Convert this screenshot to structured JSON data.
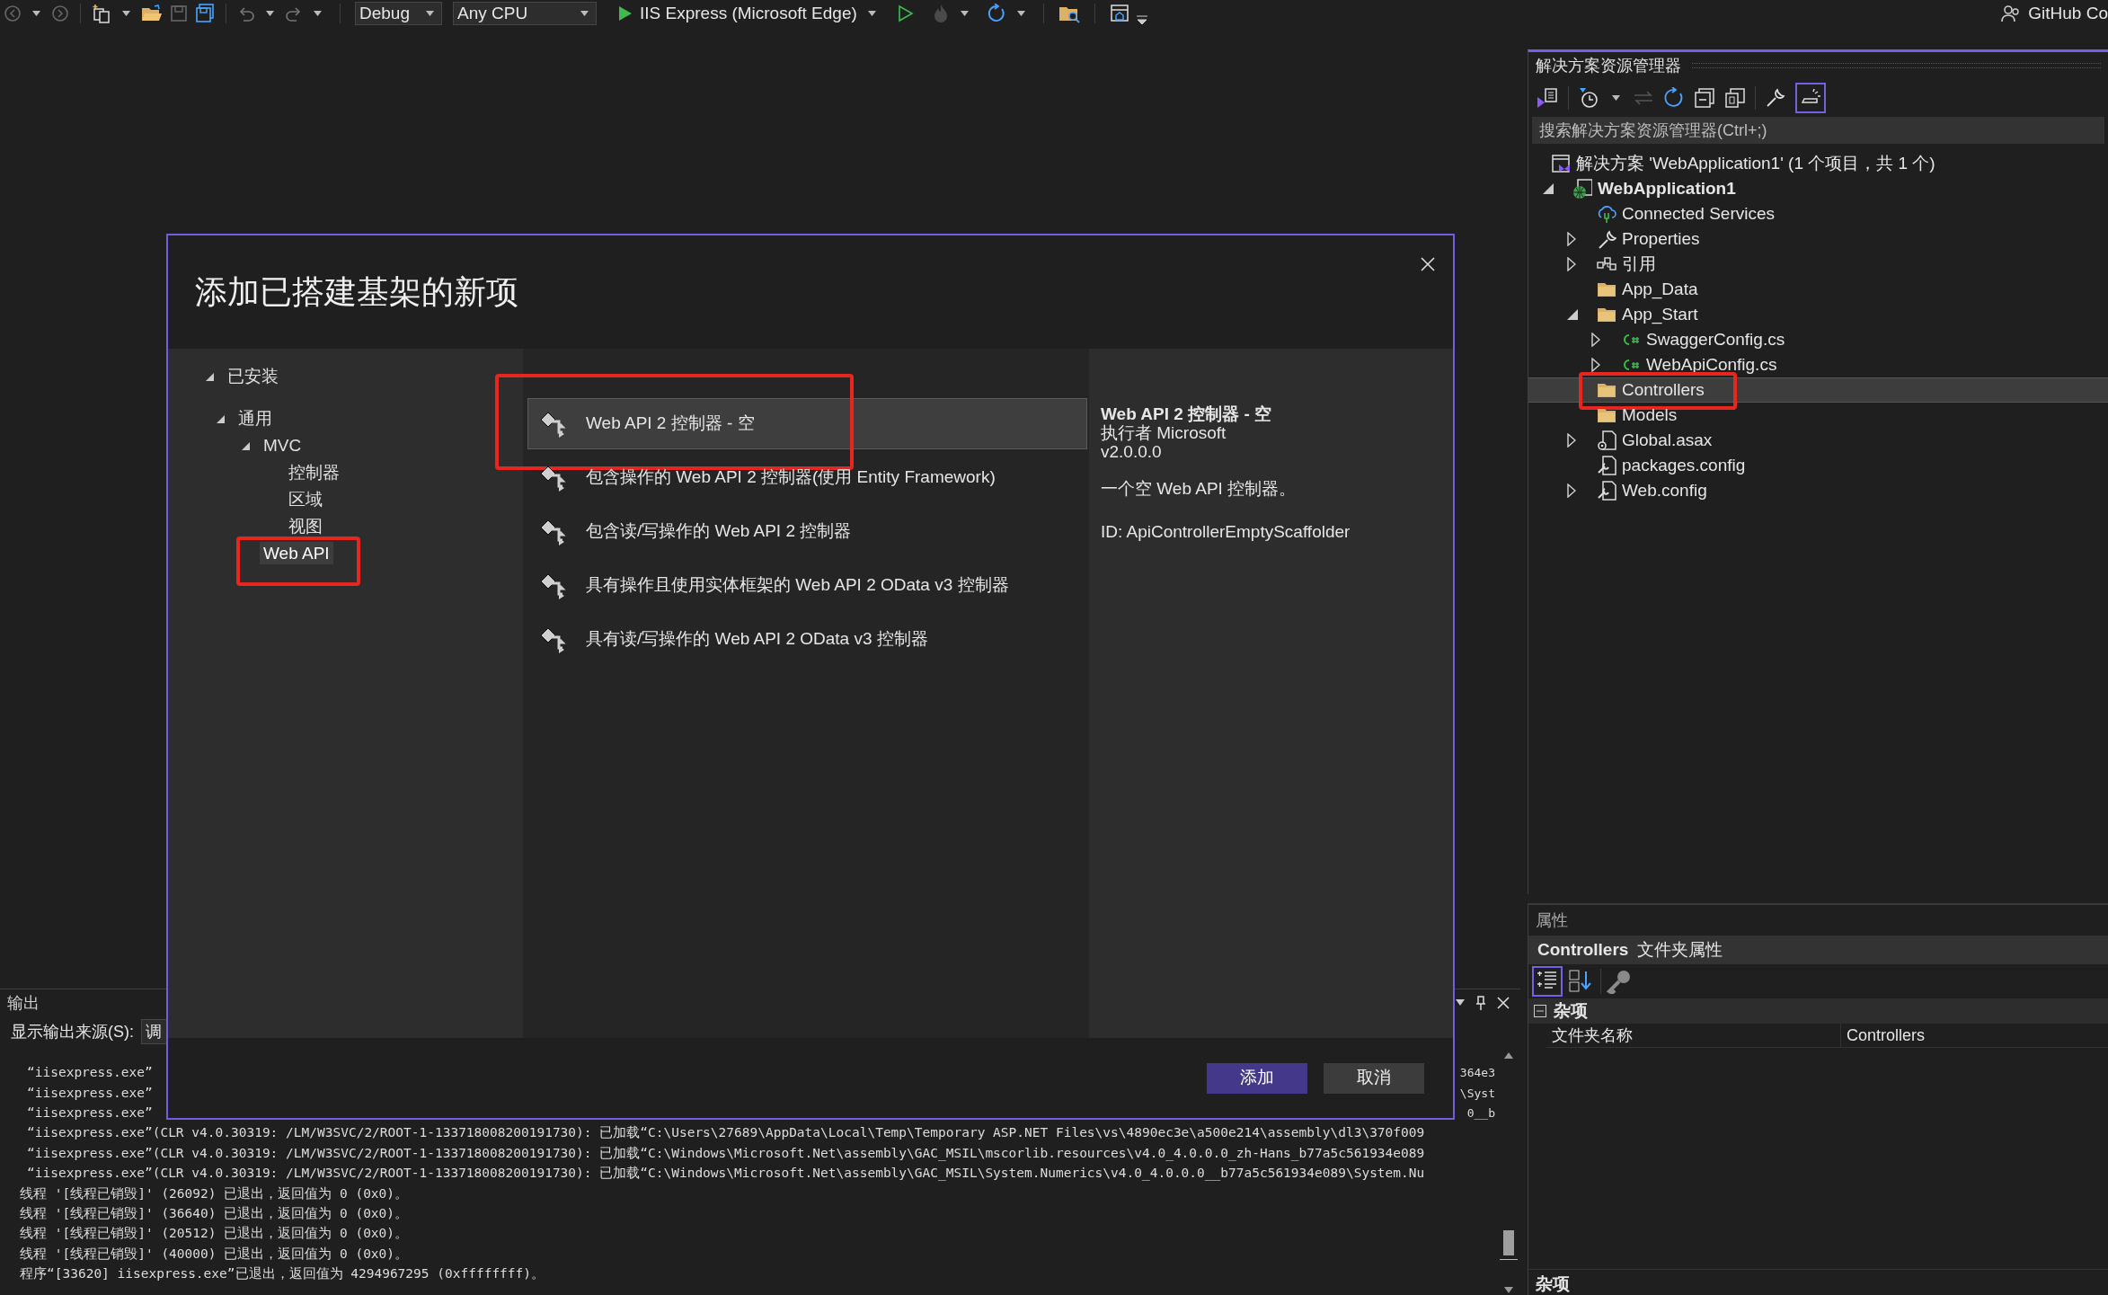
{
  "toolbar": {
    "configuration": "Debug",
    "platform": "Any CPU",
    "run_target": "IIS Express (Microsoft Edge)",
    "account": "GitHub Co"
  },
  "solution_explorer": {
    "title": "解决方案资源管理器",
    "search": {
      "placeholder": "搜索解决方案资源管理器(Ctrl+;)"
    },
    "tree": [
      {
        "label": "解决方案 'WebApplication1' (1 个项目，共 1 个)",
        "kind": "solution",
        "selected": false,
        "annotated": false,
        "children": [
          {
            "label": "WebApplication1",
            "kind": "project",
            "expanded": true,
            "selected": false,
            "annotated": false,
            "children": [
              {
                "label": "Connected Services",
                "kind": "cloud",
                "selected": false,
                "annotated": false
              },
              {
                "label": "Properties",
                "kind": "wrench",
                "expanded": false,
                "selected": false,
                "annotated": false
              },
              {
                "label": "引用",
                "kind": "references",
                "expanded": false,
                "selected": false,
                "annotated": false
              },
              {
                "label": "App_Data",
                "kind": "folder",
                "selected": false,
                "annotated": false
              },
              {
                "label": "App_Start",
                "kind": "folder",
                "expanded": true,
                "selected": false,
                "annotated": false,
                "children": [
                  {
                    "label": "SwaggerConfig.cs",
                    "kind": "csharp",
                    "expanded": false,
                    "selected": false,
                    "annotated": false
                  },
                  {
                    "label": "WebApiConfig.cs",
                    "kind": "csharp",
                    "expanded": false,
                    "selected": false,
                    "annotated": false
                  }
                ]
              },
              {
                "label": "Controllers",
                "kind": "folder",
                "selected": true,
                "annotated": true
              },
              {
                "label": "Models",
                "kind": "folder",
                "selected": false,
                "annotated": false
              },
              {
                "label": "Global.asax",
                "kind": "file-gear",
                "expanded": false,
                "selected": false,
                "annotated": false
              },
              {
                "label": "packages.config",
                "kind": "file-config",
                "selected": false,
                "annotated": false
              },
              {
                "label": "Web.config",
                "kind": "file-config",
                "expanded": false,
                "selected": false,
                "annotated": false
              }
            ]
          }
        ]
      }
    ]
  },
  "dialog": {
    "title": "添加已搭建基架的新项",
    "categories": [
      {
        "label": "已安装",
        "expanded": true,
        "selected": false,
        "annotated": false,
        "children": [
          {
            "label": "通用",
            "expanded": true,
            "selected": false,
            "annotated": false,
            "children": [
              {
                "label": "MVC",
                "expanded": true,
                "selected": false,
                "annotated": false,
                "children": [
                  {
                    "label": "控制器",
                    "selected": false,
                    "annotated": false
                  },
                  {
                    "label": "区域",
                    "selected": false,
                    "annotated": false
                  },
                  {
                    "label": "视图",
                    "selected": false,
                    "annotated": false
                  }
                ]
              },
              {
                "label": "Web API",
                "selected": true,
                "annotated": true
              }
            ]
          }
        ]
      }
    ],
    "templates": [
      {
        "label": "Web API 2 控制器 - 空",
        "selected": true,
        "annotated": true
      },
      {
        "label": "包含操作的 Web API 2 控制器(使用 Entity Framework)",
        "selected": false,
        "annotated": false
      },
      {
        "label": "包含读/写操作的 Web API 2 控制器",
        "selected": false,
        "annotated": false
      },
      {
        "label": "具有操作且使用实体框架的 Web API 2 OData v3 控制器",
        "selected": false,
        "annotated": false
      },
      {
        "label": "具有读/写操作的 Web API 2 OData v3 控制器",
        "selected": false,
        "annotated": false
      }
    ],
    "details": {
      "name": "Web API 2 控制器 - 空",
      "author": "执行者 Microsoft",
      "version": "v2.0.0.0",
      "description": "一个空 Web API 控制器。",
      "id": "ID: ApiControllerEmptyScaffolder"
    },
    "buttons": [
      {
        "label": "添加",
        "kind": "primary"
      },
      {
        "label": "取消",
        "kind": "secondary"
      }
    ]
  },
  "properties": {
    "title": "属性",
    "object_name": "Controllers",
    "object_type": "文件夹属性",
    "category": {
      "label": "杂项",
      "expanded": true
    },
    "rows": [
      {
        "name": "文件夹名称",
        "value": "Controllers"
      }
    ],
    "description_title": "杂项"
  },
  "output": {
    "title": "输出",
    "source_label": "显示输出来源(S):",
    "source_value": "调",
    "lines": [
      {
        "text": "“iisexpress.exe”",
        "tail": "364e3"
      },
      {
        "text": "“iisexpress.exe”",
        "tail": "\\Syst"
      },
      {
        "text": "“iisexpress.exe”",
        "tail": "0__b"
      },
      {
        "text": "“iisexpress.exe”(CLR v4.0.30319: /LM/W3SVC/2/ROOT-1-133718008200191730): 已加载“C:\\Users\\27689\\AppData\\Local\\Temp\\Temporary ASP.NET Files\\vs\\4890ec3e\\a500e214\\assembly\\dl3\\370f009"
      },
      {
        "text": "“iisexpress.exe”(CLR v4.0.30319: /LM/W3SVC/2/ROOT-1-133718008200191730): 已加载“C:\\Windows\\Microsoft.Net\\assembly\\GAC_MSIL\\mscorlib.resources\\v4.0_4.0.0.0_zh-Hans_b77a5c561934e089"
      },
      {
        "text": "“iisexpress.exe”(CLR v4.0.30319: /LM/W3SVC/2/ROOT-1-133718008200191730): 已加载“C:\\Windows\\Microsoft.Net\\assembly\\GAC_MSIL\\System.Numerics\\v4.0_4.0.0.0__b77a5c561934e089\\System.Nu"
      },
      {
        "text": "线程 '[线程已销毁]' (26092) 已退出，返回值为 0 (0x0)。"
      },
      {
        "text": "线程 '[线程已销毁]' (36640) 已退出，返回值为 0 (0x0)。"
      },
      {
        "text": "线程 '[线程已销毁]' (20512) 已退出，返回值为 0 (0x0)。"
      },
      {
        "text": "线程 '[线程已销毁]' (40000) 已退出，返回值为 0 (0x0)。"
      },
      {
        "text": "程序“[33620] iisexpress.exe”已退出，返回值为 4294967295 (0xffffffff)。"
      }
    ]
  }
}
